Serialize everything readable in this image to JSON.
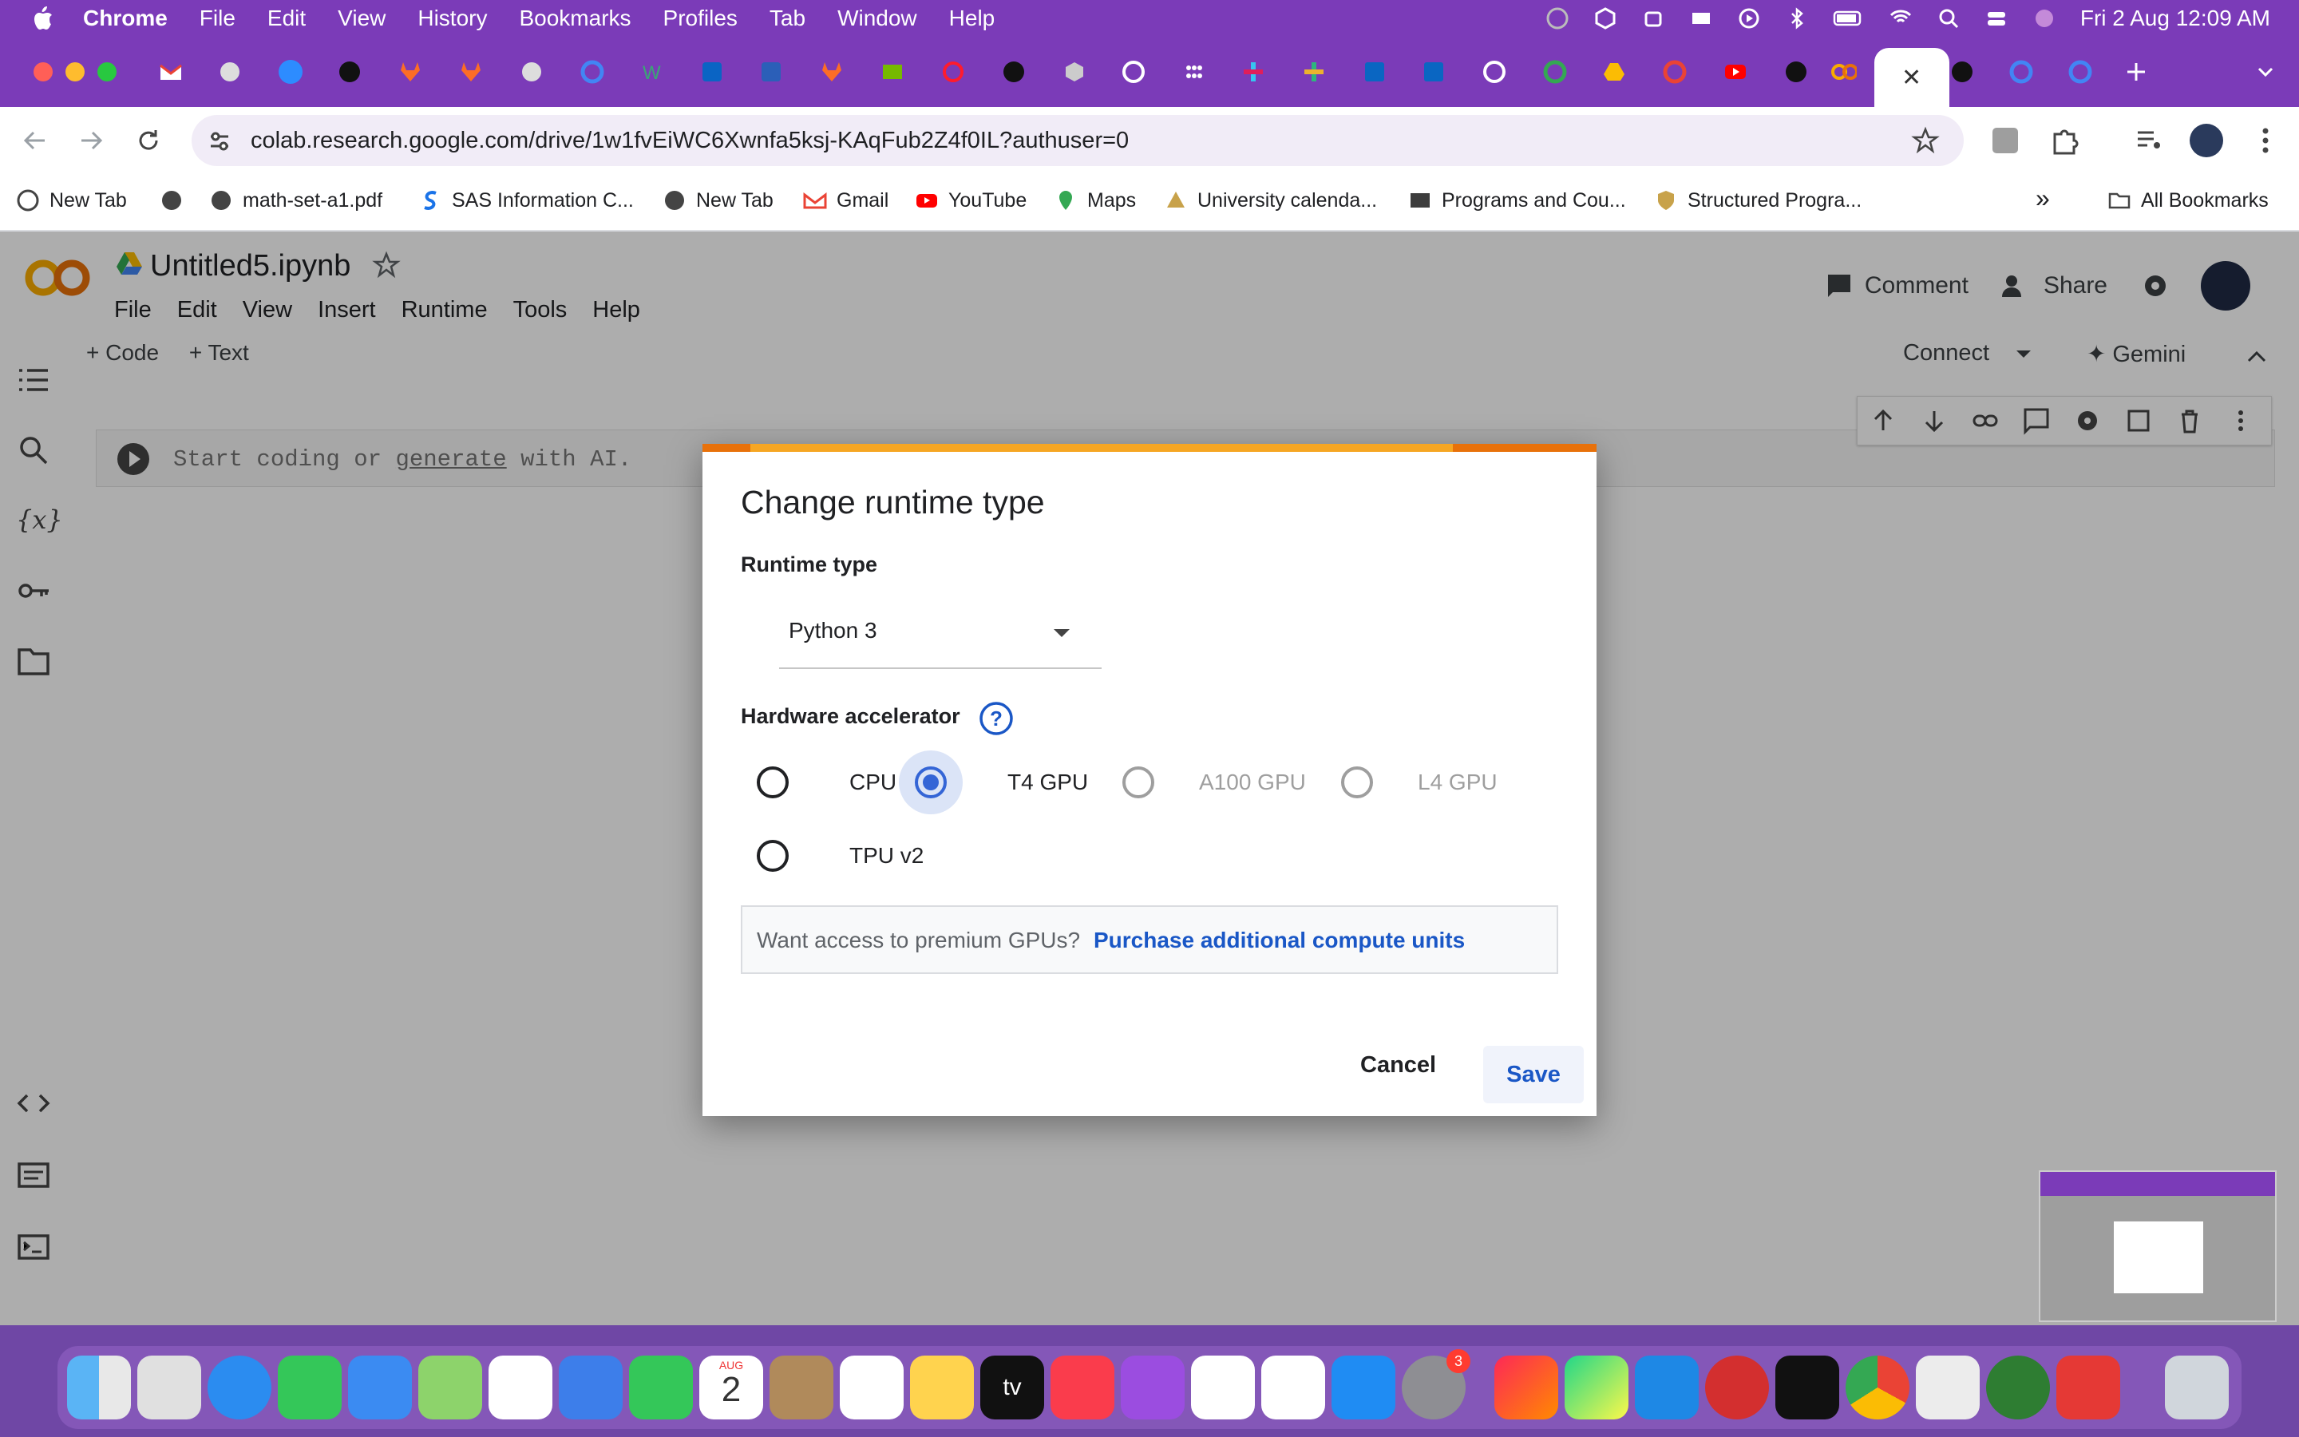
{
  "menubar": {
    "app_name": "Chrome",
    "items": [
      "File",
      "Edit",
      "View",
      "History",
      "Bookmarks",
      "Profiles",
      "Tab",
      "Window",
      "Help"
    ],
    "clock": "Fri 2 Aug  12:09 AM"
  },
  "browser": {
    "url": "colab.research.google.com/drive/1w1fvEiWC6Xwnfa5ksj-KAqFub2Z4f0IL?authuser=0",
    "active_tab_close": "✕"
  },
  "bookmarks": {
    "items": [
      "New Tab",
      "math-set-a1.pdf",
      "SAS Information C...",
      "New Tab",
      "Gmail",
      "YouTube",
      "Maps",
      "University calenda...",
      "Programs and Cou...",
      "Structured Progra..."
    ],
    "overflow": "»",
    "all_bookmarks": "All Bookmarks"
  },
  "colab": {
    "notebook_title": "Untitled5.ipynb",
    "menu": [
      "File",
      "Edit",
      "View",
      "Insert",
      "Runtime",
      "Tools",
      "Help"
    ],
    "comment": "Comment",
    "share": "Share",
    "add_code": "+ Code",
    "add_text": "+ Text",
    "connect": "Connect",
    "gemini": "Gemini",
    "cell_placeholder_1": "Start coding or ",
    "cell_placeholder_link": "generate",
    "cell_placeholder_2": " with AI."
  },
  "dialog": {
    "title": "Change runtime type",
    "runtime_label": "Runtime type",
    "runtime_value": "Python 3",
    "hw_label": "Hardware accelerator",
    "options": [
      {
        "label": "CPU",
        "state": "unchecked"
      },
      {
        "label": "T4 GPU",
        "state": "checked"
      },
      {
        "label": "A100 GPU",
        "state": "disabled"
      },
      {
        "label": "L4 GPU",
        "state": "disabled"
      },
      {
        "label": "TPU v2",
        "state": "unchecked"
      }
    ],
    "premium_question": "Want access to premium GPUs?",
    "premium_link": "Purchase additional compute units",
    "cancel": "Cancel",
    "save": "Save"
  },
  "dock": {
    "calendar_month": "AUG",
    "calendar_day": "2",
    "settings_badge": "3"
  }
}
